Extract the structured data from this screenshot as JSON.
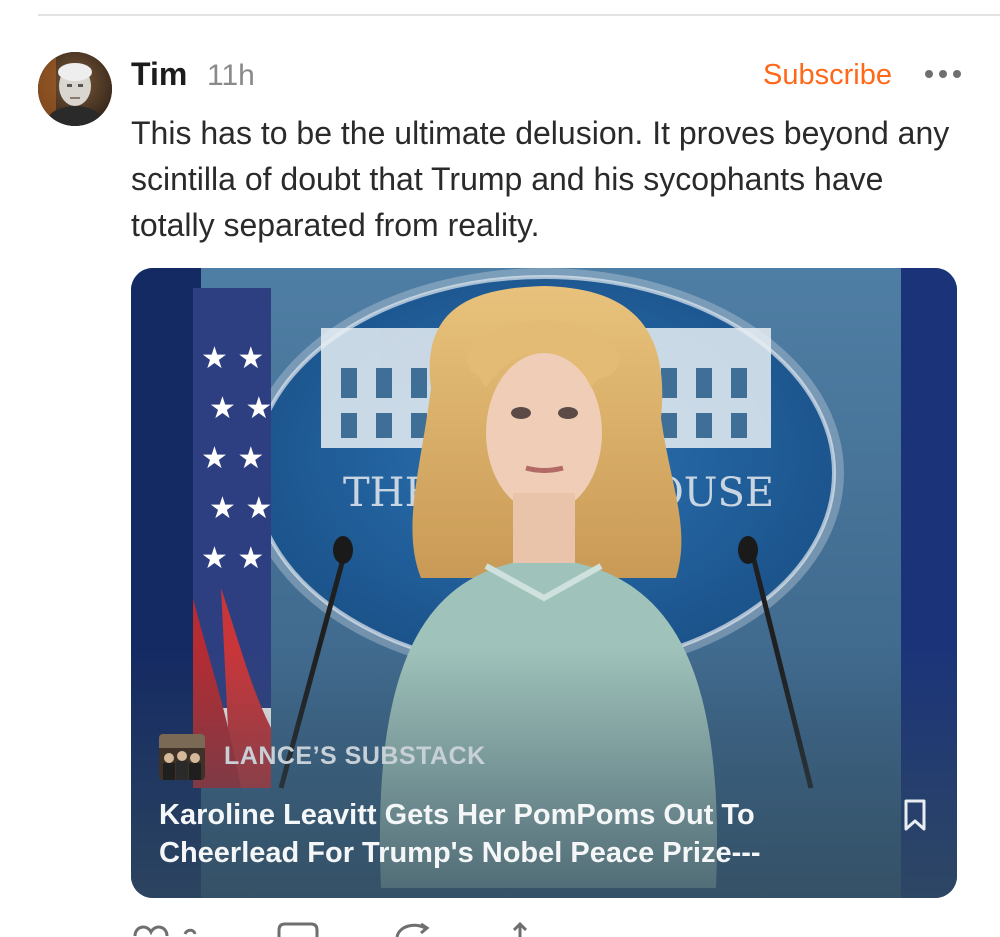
{
  "post": {
    "author": "Tim",
    "timestamp": "11h",
    "subscribe_label": "Subscribe",
    "body": "This has to be the ultimate delusion.  It proves beyond any scintilla of doubt that Trump and his sycophants have totally separated from reality."
  },
  "card": {
    "publication": "LANCE’S SUBSTACK",
    "title": "Karoline Leavitt Gets Her PomPoms Out To Cheerlead For Trump's Nobel Peace Prize---",
    "image_text": {
      "left": "THE",
      "right": "OUSE"
    }
  },
  "icons": {
    "more": "more-horizontal-icon",
    "bookmark": "bookmark-icon",
    "like": "heart-icon",
    "comment": "comment-icon",
    "restack": "restack-icon",
    "share": "share-icon"
  },
  "colors": {
    "accent": "#ff6719",
    "card_background": "#344d5e"
  }
}
